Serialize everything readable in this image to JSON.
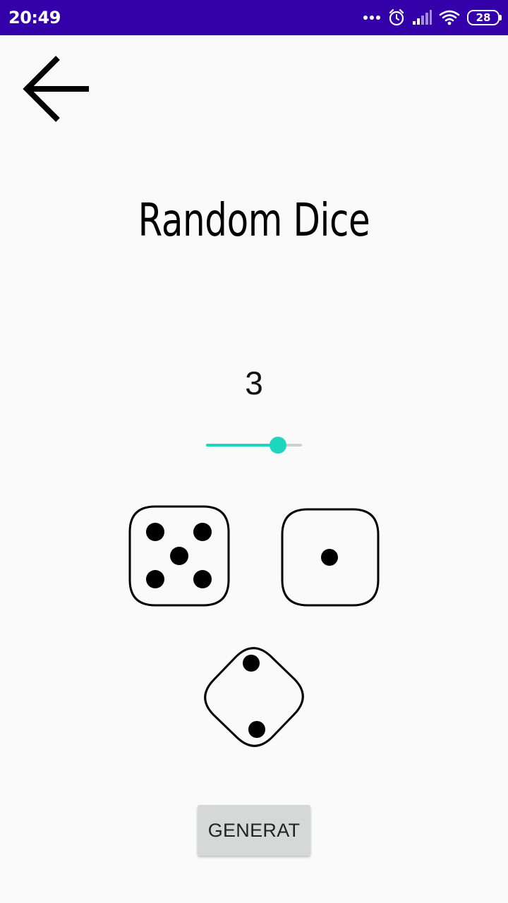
{
  "status_bar": {
    "time": "20:49",
    "battery_level": "28",
    "background_color": "#3300aa",
    "icons": [
      "more-dots-icon",
      "alarm-icon",
      "signal-icon",
      "wifi-icon",
      "battery-icon"
    ]
  },
  "header": {
    "back_icon": "arrow-left-icon"
  },
  "title": "Random Dice",
  "dice_count": {
    "value": "3"
  },
  "slider": {
    "fraction": 0.75,
    "accent_color": "#1ed6c0"
  },
  "dice": [
    {
      "face": 5
    },
    {
      "face": 1
    },
    {
      "face": 2
    }
  ],
  "generate_button": {
    "label": "GENERAT"
  }
}
